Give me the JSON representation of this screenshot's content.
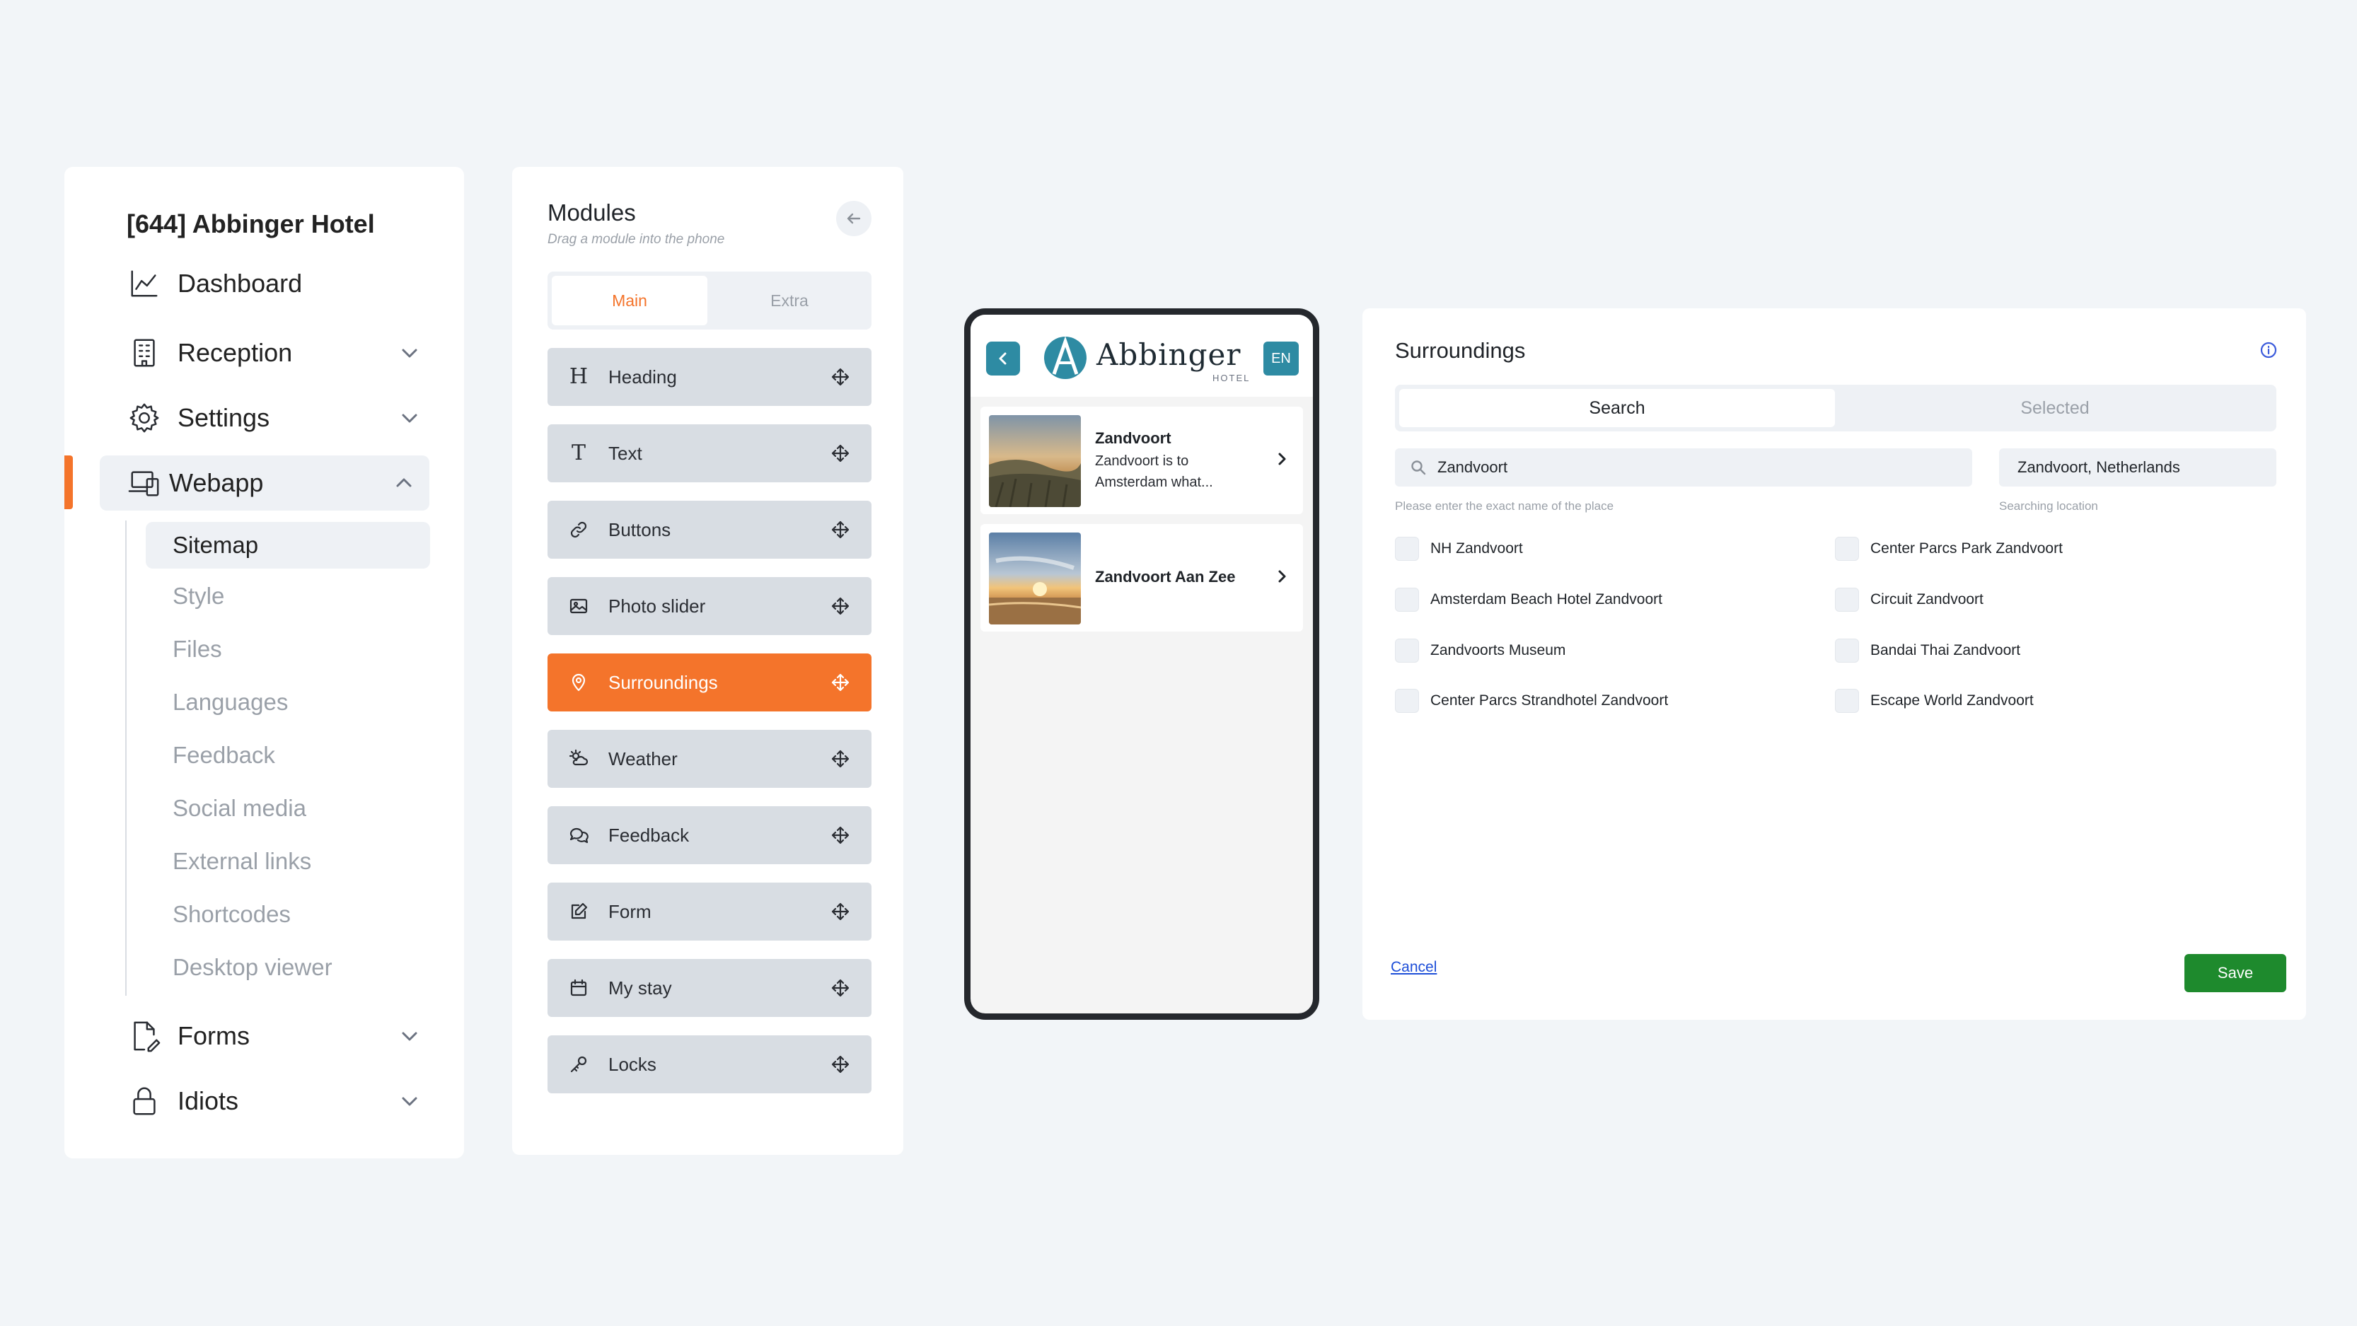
{
  "nav": {
    "hotel_title": "[644] Abbinger Hotel",
    "items": {
      "dashboard": "Dashboard",
      "reception": "Reception",
      "settings": "Settings",
      "webapp": "Webapp",
      "forms": "Forms",
      "idiots": "Idiots"
    },
    "webapp_sub": [
      "Sitemap",
      "Style",
      "Files",
      "Languages",
      "Feedback",
      "Social media",
      "External links",
      "Shortcodes",
      "Desktop viewer"
    ],
    "active_sub": "Sitemap",
    "accent_color": "#f4742b"
  },
  "modules": {
    "title": "Modules",
    "subtitle": "Drag a module into the phone",
    "tabs": [
      "Main",
      "Extra"
    ],
    "active_tab": "Main",
    "items": [
      {
        "label": "Heading",
        "icon": "heading-icon"
      },
      {
        "label": "Text",
        "icon": "text-icon"
      },
      {
        "label": "Buttons",
        "icon": "link-icon"
      },
      {
        "label": "Photo slider",
        "icon": "image-icon"
      },
      {
        "label": "Surroundings",
        "icon": "map-pin-icon",
        "active": true
      },
      {
        "label": "Weather",
        "icon": "weather-icon"
      },
      {
        "label": "Feedback",
        "icon": "chat-icon"
      },
      {
        "label": "Form",
        "icon": "edit-icon"
      },
      {
        "label": "My stay",
        "icon": "calendar-icon"
      },
      {
        "label": "Locks",
        "icon": "key-icon"
      }
    ]
  },
  "phone": {
    "logo_text": "Abbinger",
    "logo_sub": "HOTEL",
    "language": "EN",
    "brand_color": "#2e8ba3",
    "places": [
      {
        "title": "Zandvoort",
        "description": "Zandvoort is to Amsterdam what..."
      },
      {
        "title": "Zandvoort Aan Zee",
        "description": ""
      }
    ]
  },
  "surroundings": {
    "title": "Surroundings",
    "tabs": [
      "Search",
      "Selected"
    ],
    "active_tab": "Search",
    "search_value": "Zandvoort",
    "search_hint": "Please enter the exact name of the place",
    "location_value": "Zandvoort, Netherlands",
    "location_hint": "Searching location",
    "results_left": [
      "NH Zandvoort",
      "Amsterdam Beach Hotel Zandvoort",
      "Zandvoorts Museum",
      "Center Parcs Strandhotel Zandvoort"
    ],
    "results_right": [
      "Center Parcs Park Zandvoort",
      "Circuit Zandvoort",
      "Bandai Thai Zandvoort",
      "Escape World Zandvoort"
    ],
    "cancel_label": "Cancel",
    "save_label": "Save",
    "save_color": "#1e8a2d"
  }
}
